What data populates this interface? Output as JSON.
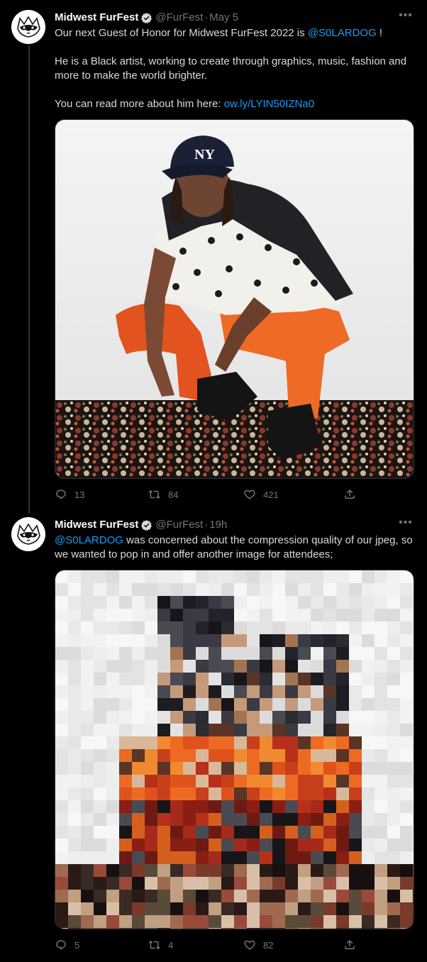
{
  "tweets": [
    {
      "author_name": "Midwest FurFest",
      "handle": "@FurFest",
      "dot": "·",
      "time": "May 5",
      "text_line1_prefix": "Our next Guest of Honor for Midwest FurFest 2022 is ",
      "text_line1_mention": "@S0LARDOG",
      "text_line1_suffix": " !",
      "text_para2": "He is a Black artist, working to create through graphics, music, fashion and more to make the world brighter.",
      "text_para3_prefix": "You can read more about  him here:  ",
      "text_para3_link": "ow.ly/LYIN50IZNa0",
      "replies": "13",
      "retweets": "84",
      "likes": "421",
      "media": "photo of person crouching in orange pants on patterned rug"
    },
    {
      "author_name": "Midwest FurFest",
      "handle": "@FurFest",
      "dot": "·",
      "time": "19h",
      "text_mention": "@S0LARDOG",
      "text_rest": " was concerned about the compression quality of our jpeg, so we wanted to pop in and offer another image for attendees;",
      "replies": "5",
      "retweets": "4",
      "likes": "82",
      "media": "heavily pixelated version of the same photo"
    }
  ],
  "icons": {
    "reply": "reply-icon",
    "retweet": "retweet-icon",
    "like": "heart-icon",
    "share": "share-icon",
    "verified": "verified-badge-icon",
    "more": "more-icon"
  },
  "colors": {
    "background": "#000000",
    "link": "#1d9bf0",
    "muted": "#6e767d",
    "text": "#d9d9d9"
  }
}
